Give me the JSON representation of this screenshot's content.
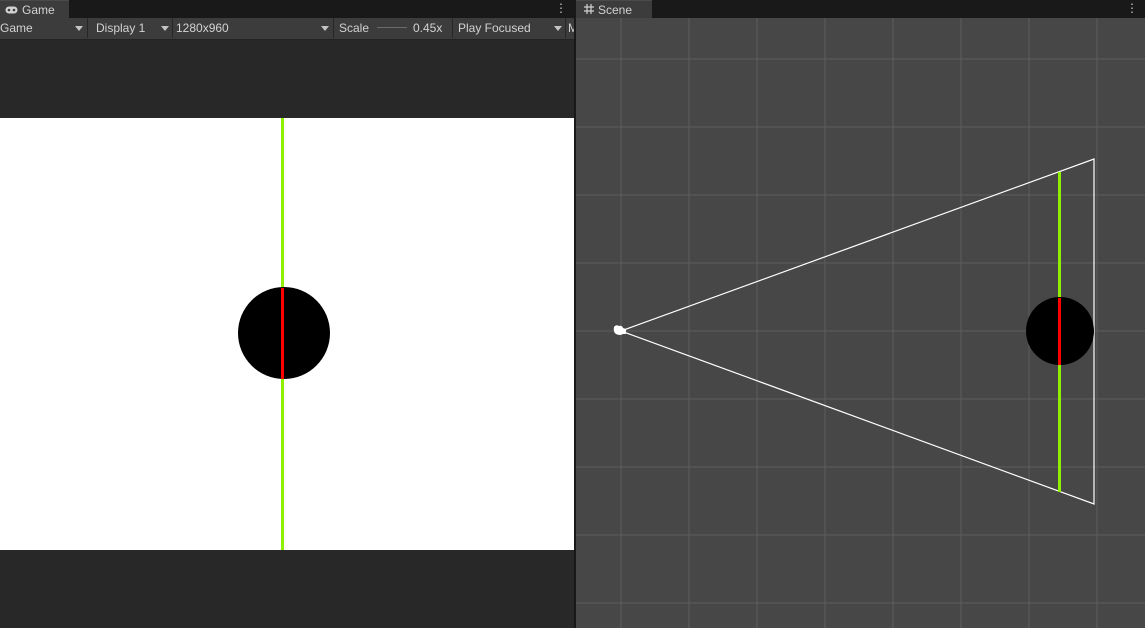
{
  "game_panel": {
    "tab_label": "Game",
    "tab_icon": "gamepad-icon",
    "more_icon": "kebab-menu-icon",
    "toolbar": {
      "view_mode": "Game",
      "display": "Display 1",
      "resolution": "1280x960",
      "scale_label": "Scale",
      "scale_value": "0.45x",
      "play_mode": "Play Focused",
      "overflow_glyph": "M"
    },
    "render": {
      "background_color": "#ffffff",
      "letterbox_color": "#282828",
      "line_color": "#8ef000",
      "circle_color": "#000000",
      "center_line_color": "#ff0000"
    }
  },
  "scene_panel": {
    "tab_label": "Scene",
    "tab_icon": "grid-icon",
    "more_icon": "kebab-menu-icon",
    "render": {
      "background_color": "#474747",
      "grid_color": "#5d5d5d",
      "frustum_color": "#ffffff",
      "line_color": "#8ef000",
      "circle_color": "#000000",
      "center_line_color": "#ff0000",
      "camera_icon": "camera-gizmo-icon"
    }
  }
}
